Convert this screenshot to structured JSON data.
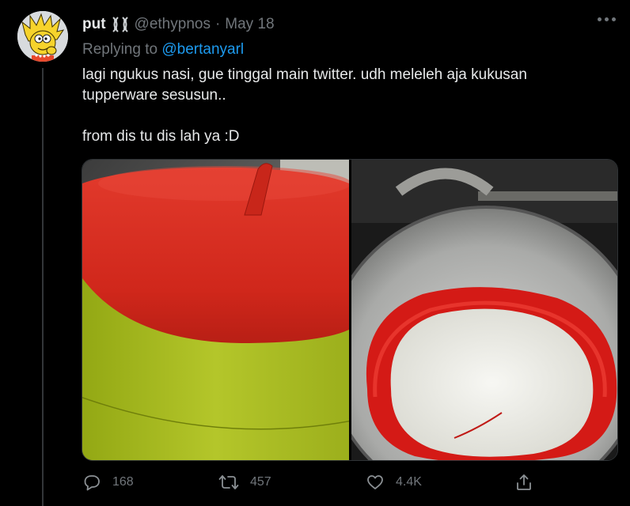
{
  "tweet": {
    "display_name": "put",
    "name_emoji": "dna",
    "handle": "@ethypnos",
    "separator": "·",
    "date": "May 18",
    "reply_prefix": "Replying to",
    "reply_to": "@bertanyarl",
    "text_line1": "lagi ngukus nasi, gue tinggal main twitter. udh meleleh aja kukusan",
    "text_line2": "tupperware sesusun..",
    "text_line3": "from dis tu dis lah ya :D"
  },
  "media": {
    "image1": "red-lid-green-tupperware-steamer",
    "image2": "melted-red-container-with-rice-in-wok"
  },
  "actions": {
    "reply_icon": "reply-icon",
    "reply_count": "168",
    "retweet_icon": "retweet-icon",
    "retweet_count": "457",
    "like_icon": "heart-icon",
    "like_count": "4.4K",
    "share_icon": "share-icon"
  },
  "colors": {
    "background": "#000000",
    "text_primary": "#e7e9ea",
    "text_secondary": "#71767b",
    "link": "#1d9bf0",
    "thread_line": "#333639"
  }
}
